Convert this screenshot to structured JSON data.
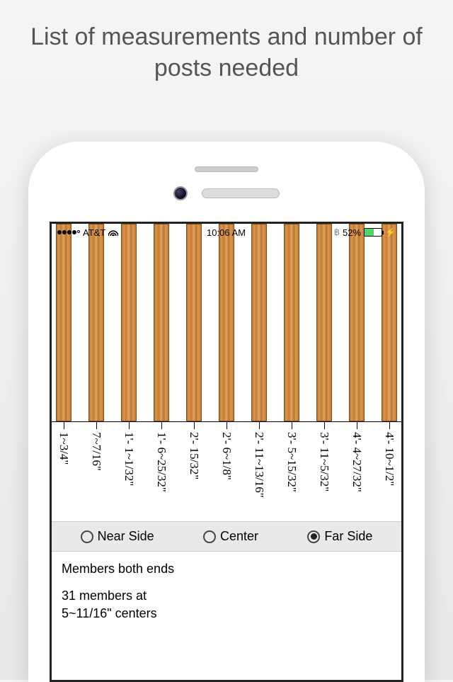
{
  "promo": {
    "title": "List of measurements and number of posts needed"
  },
  "status": {
    "carrier": "AT&T",
    "time": "10:06 AM",
    "battery_pct": "52%"
  },
  "measurements": [
    "1~3/4\"",
    "7~7/16\"",
    "1'- 1~1/32\"",
    "1'- 6~25/32\"",
    "2'- 15/32\"",
    "2'- 6~1/8\"",
    "2'- 11~13/16\"",
    "3'- 5~15/32\"",
    "3'- 11~5/32\"",
    "4'- 4~27/32\"",
    "4'- 10~1/2\""
  ],
  "selector": {
    "options": [
      "Near Side",
      "Center",
      "Far Side"
    ],
    "selected": "Far Side"
  },
  "summary": {
    "line1": "Members both ends",
    "line2a": "31 members at",
    "line2b": "5~11/16\" centers"
  }
}
